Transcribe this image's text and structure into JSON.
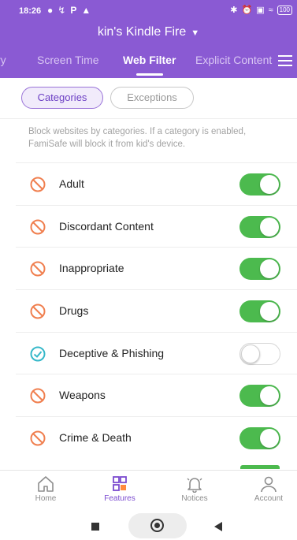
{
  "status_bar": {
    "time": "18:26",
    "battery": "100"
  },
  "header": {
    "device_name": "kin's Kindle Fire"
  },
  "tabs": [
    {
      "label": "ry",
      "active": false
    },
    {
      "label": "Screen Time",
      "active": false
    },
    {
      "label": "Web Filter",
      "active": true
    },
    {
      "label": "Explicit Content",
      "active": false
    }
  ],
  "segments": {
    "categories": "Categories",
    "exceptions": "Exceptions",
    "selected": "Categories"
  },
  "info_text": "Block websites by categories. If a category is enabled, FamiSafe will block it from kid's device.",
  "categories": [
    {
      "label": "Adult",
      "enabled": true,
      "icon": "block-icon"
    },
    {
      "label": "Discordant Content",
      "enabled": true,
      "icon": "block-icon"
    },
    {
      "label": "Inappropriate",
      "enabled": true,
      "icon": "block-icon"
    },
    {
      "label": "Drugs",
      "enabled": true,
      "icon": "block-icon"
    },
    {
      "label": "Deceptive & Phishing",
      "enabled": false,
      "icon": "check-circle-icon"
    },
    {
      "label": "Weapons",
      "enabled": true,
      "icon": "block-icon"
    },
    {
      "label": "Crime & Death",
      "enabled": true,
      "icon": "block-icon"
    }
  ],
  "bottom_nav": [
    {
      "label": "Home",
      "icon": "home-icon",
      "active": false
    },
    {
      "label": "Features",
      "icon": "features-grid-icon",
      "active": true
    },
    {
      "label": "Notices",
      "icon": "bell-icon",
      "active": false
    },
    {
      "label": "Account",
      "icon": "account-icon",
      "active": false
    }
  ],
  "colors": {
    "header": "#8a5ad3",
    "toggle_on": "#4cba4e",
    "block_icon": "#f07f4f",
    "allowed_icon": "#35b8c9",
    "active_nav": "#7b4bd0"
  }
}
